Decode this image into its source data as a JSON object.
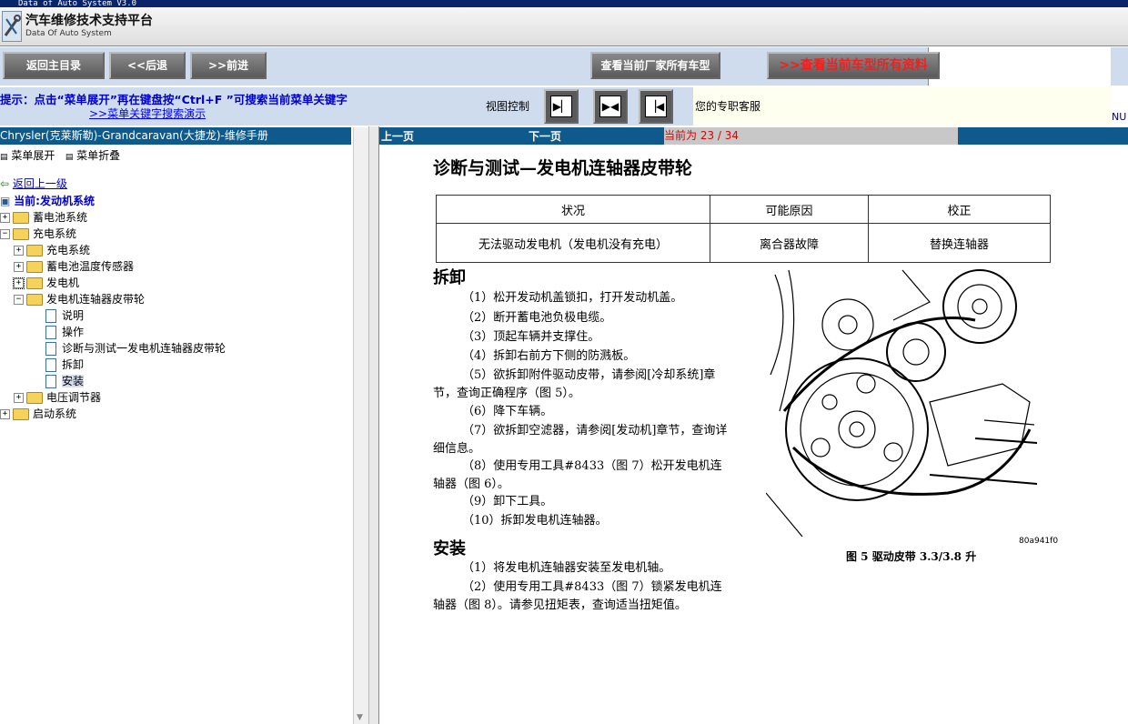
{
  "window": {
    "title": "Data of Auto System V3.0"
  },
  "header": {
    "app_title": "汽车维修技术支持平台",
    "app_subtitle": "Data Of Auto System"
  },
  "toolbar": {
    "home": "返回主目录",
    "back": "<<后退",
    "forward": ">>前进",
    "all_models": "查看当前厂家所有车型",
    "all_data": ">>查看当前车型所有资料"
  },
  "hint": {
    "text": "提示：点击“菜单展开”再在键盘按“Ctrl+F ”可搜索当前菜单关键字",
    "link": ">>菜单关键字搜索演示",
    "view_control": "视图控制",
    "service": "您的专职客服",
    "num": "NU"
  },
  "left": {
    "heading": "Chrysler(克莱斯勒)-Grandcaravan(大捷龙)-维修手册",
    "expand": "菜单展开",
    "collapse": "菜单折叠",
    "back_up": "返回上一级",
    "current": "当前:发动机系统",
    "tree": {
      "battery": "蓄电池系统",
      "charging": "充电系统",
      "charging_sys": "充电系统",
      "battery_temp": "蓄电池温度传感器",
      "generator": "发电机",
      "pulley": "发电机连轴器皮带轮",
      "desc": "说明",
      "operation": "操作",
      "diag": "诊断与测试一发电机连轴器皮带轮",
      "removal": "拆卸",
      "install": "安装",
      "regulator": "电压调节器",
      "starting": "启动系统"
    }
  },
  "nav": {
    "prev": "上一页",
    "next": "下一页",
    "page_info": "当前为 23 / 34"
  },
  "doc": {
    "title": "诊断与测试—发电机连轴器皮带轮",
    "table": {
      "headers": [
        "状况",
        "可能原因",
        "校正"
      ],
      "row": [
        "无法驱动发电机（发电机没有充电）",
        "离合器故障",
        "替换连轴器"
      ]
    },
    "removal_title": "拆卸",
    "removal_steps": [
      "（1）松开发动机盖锁扣，打开发动机盖。",
      "（2）断开蓄电池负极电缆。",
      "（3）顶起车辆并支撑住。",
      "（4）拆卸右前方下侧的防溅板。",
      "（5）欲拆卸附件驱动皮带，请参阅[冷却系统]章节，查询正确程序（图 5）。",
      "（6）降下车辆。",
      "（7）欲拆卸空滤器，请参阅[发动机]章节，查询详细信息。",
      "（8）使用专用工具#8433（图 7）松开发电机连轴器（图 6）。",
      "（9）卸下工具。",
      "（10）拆卸发电机连轴器。"
    ],
    "install_title": "安装",
    "install_steps": [
      "（1）将发电机连轴器安装至发电机轴。",
      "（2）使用专用工具#8433（图 7）锁紧发电机连轴器（图 8）。请参见扭矩表，查询适当扭矩值。"
    ],
    "figure_code": "80a941f0",
    "figure_caption": "图 5 驱动皮带 3.3/3.8 升"
  }
}
